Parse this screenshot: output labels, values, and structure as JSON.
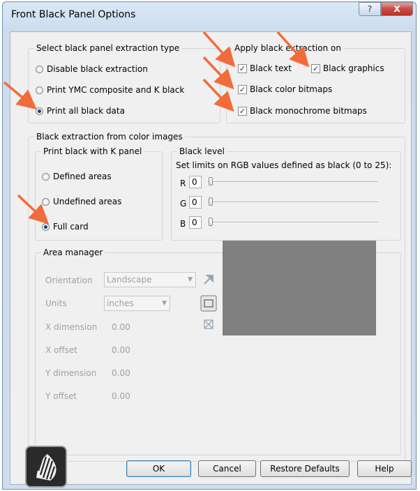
{
  "window": {
    "title": "Front Black Panel Options",
    "help_glyph": "?",
    "close_glyph": "X"
  },
  "extraction_type": {
    "legend": "Select black panel extraction type",
    "options": [
      {
        "label": "Disable black extraction",
        "selected": false
      },
      {
        "label": "Print YMC composite and K black",
        "selected": false
      },
      {
        "label": "Print all black data",
        "selected": true
      }
    ]
  },
  "apply_on": {
    "legend": "Apply black extraction on",
    "items": [
      {
        "label": "Black text",
        "checked": true
      },
      {
        "label": "Black graphics",
        "checked": true
      },
      {
        "label": "Black color bitmaps",
        "checked": true
      },
      {
        "label": "Black monochrome bitmaps",
        "checked": true
      }
    ]
  },
  "color_images": {
    "legend": "Black extraction from color images",
    "k_panel": {
      "legend": "Print black with K panel",
      "options": [
        {
          "label": "Defined areas",
          "selected": false
        },
        {
          "label": "Undefined areas",
          "selected": false
        },
        {
          "label": "Full card",
          "selected": true
        }
      ]
    },
    "black_level": {
      "legend": "Black level",
      "description": "Set limits on RGB values defined as black (0 to 25):",
      "channels": [
        {
          "name": "R",
          "value": "0"
        },
        {
          "name": "G",
          "value": "0"
        },
        {
          "name": "B",
          "value": "0"
        }
      ]
    }
  },
  "area_manager": {
    "legend": "Area manager",
    "orientation_label": "Orientation",
    "orientation_value": "Landscape",
    "units_label": "Units",
    "units_value": "inches",
    "fields": [
      {
        "label": "X dimension",
        "value": "0.00"
      },
      {
        "label": "X offset",
        "value": "0.00"
      },
      {
        "label": "Y dimension",
        "value": "0.00"
      },
      {
        "label": "Y offset",
        "value": "0.00"
      }
    ]
  },
  "buttons": {
    "ok": "OK",
    "cancel": "Cancel",
    "restore": "Restore Defaults",
    "help": "Help"
  },
  "colors": {
    "annotation_arrow": "#f26b3a",
    "preview_gray": "#808080"
  }
}
